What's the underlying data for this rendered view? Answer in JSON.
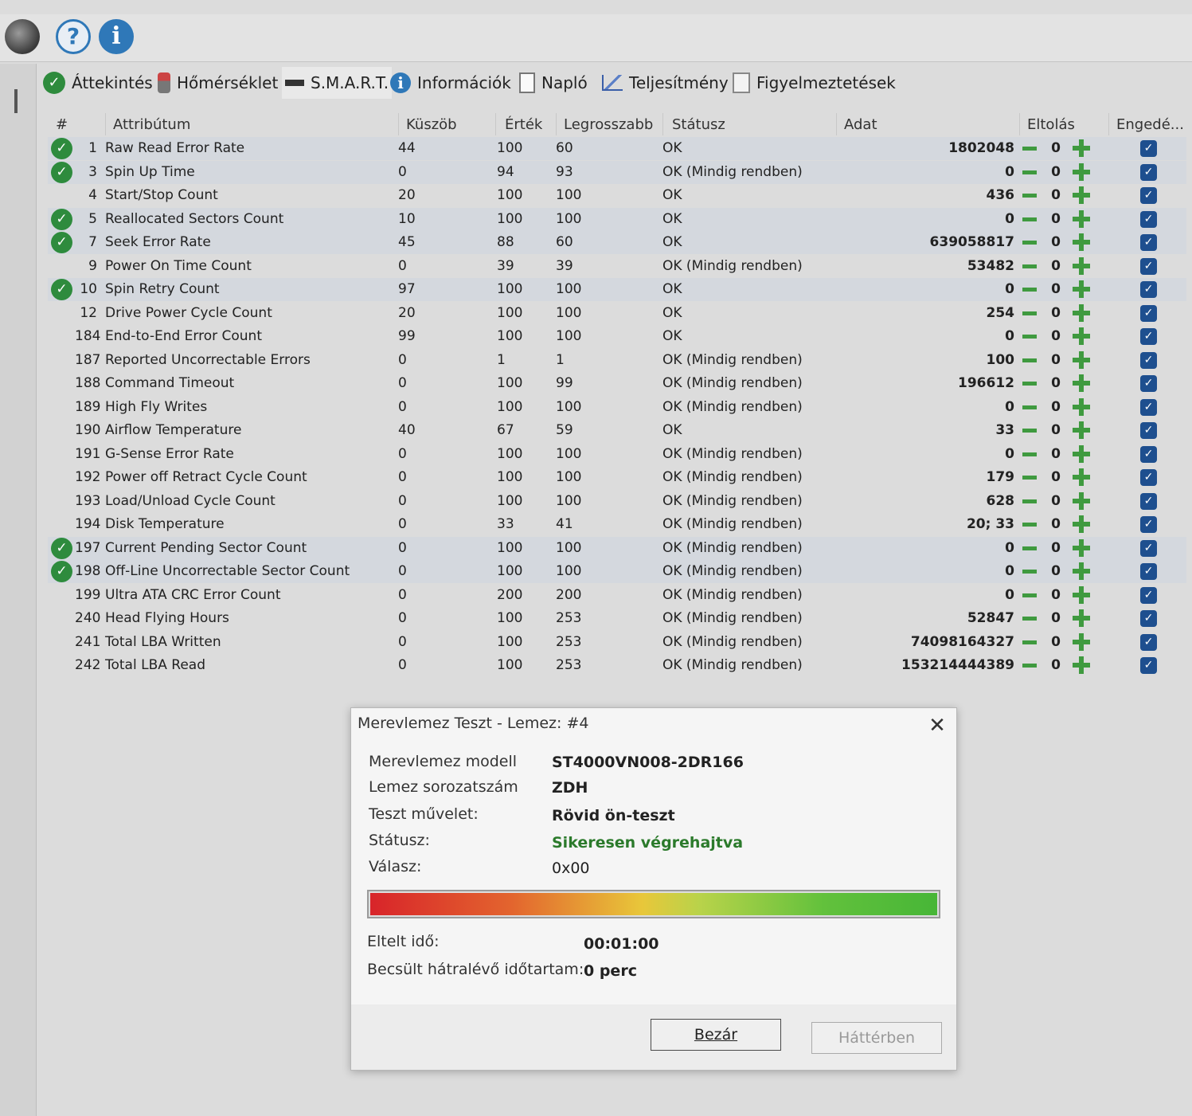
{
  "toolbar": {
    "icons": [
      "disk-icon",
      "help-icon",
      "info-icon"
    ],
    "help_glyph": "?",
    "info_glyph": "i"
  },
  "tabs": [
    {
      "label": "Áttekintés",
      "icon": "check-icon"
    },
    {
      "label": "Hőmérséklet",
      "icon": "thermometer-icon"
    },
    {
      "label": "S.M.A.R.T.",
      "icon": "smart-icon"
    },
    {
      "label": "Információk",
      "icon": "info-icon"
    },
    {
      "label": "Napló",
      "icon": "document-icon"
    },
    {
      "label": "Teljesítmény",
      "icon": "chart-icon"
    },
    {
      "label": "Figyelmeztetések",
      "icon": "warning-doc-icon"
    }
  ],
  "table": {
    "headers": {
      "num": "#",
      "attribute": "Attribútum",
      "threshold": "Küszöb",
      "value": "Érték",
      "worst": "Legrosszabb",
      "status": "Státusz",
      "data": "Adat",
      "offset": "Eltolás",
      "enabled": "Engedé..."
    },
    "rows": [
      {
        "ok": true,
        "id": "1",
        "name": "Raw Read Error Rate",
        "threshold": "44",
        "value": "100",
        "worst": "60",
        "status": "OK",
        "data": "1802048",
        "offset": "0",
        "enabled": true
      },
      {
        "ok": true,
        "id": "3",
        "name": "Spin Up Time",
        "threshold": "0",
        "value": "94",
        "worst": "93",
        "status": "OK (Mindig rendben)",
        "data": "0",
        "offset": "0",
        "enabled": true
      },
      {
        "ok": false,
        "id": "4",
        "name": "Start/Stop Count",
        "threshold": "20",
        "value": "100",
        "worst": "100",
        "status": "OK",
        "data": "436",
        "offset": "0",
        "enabled": true
      },
      {
        "ok": true,
        "id": "5",
        "name": "Reallocated Sectors Count",
        "threshold": "10",
        "value": "100",
        "worst": "100",
        "status": "OK",
        "data": "0",
        "offset": "0",
        "enabled": true
      },
      {
        "ok": true,
        "id": "7",
        "name": "Seek Error Rate",
        "threshold": "45",
        "value": "88",
        "worst": "60",
        "status": "OK",
        "data": "639058817",
        "offset": "0",
        "enabled": true
      },
      {
        "ok": false,
        "id": "9",
        "name": "Power On Time Count",
        "threshold": "0",
        "value": "39",
        "worst": "39",
        "status": "OK (Mindig rendben)",
        "data": "53482",
        "offset": "0",
        "enabled": true
      },
      {
        "ok": true,
        "id": "10",
        "name": "Spin Retry Count",
        "threshold": "97",
        "value": "100",
        "worst": "100",
        "status": "OK",
        "data": "0",
        "offset": "0",
        "enabled": true
      },
      {
        "ok": false,
        "id": "12",
        "name": "Drive Power Cycle Count",
        "threshold": "20",
        "value": "100",
        "worst": "100",
        "status": "OK",
        "data": "254",
        "offset": "0",
        "enabled": true
      },
      {
        "ok": false,
        "id": "184",
        "name": "End-to-End Error Count",
        "threshold": "99",
        "value": "100",
        "worst": "100",
        "status": "OK",
        "data": "0",
        "offset": "0",
        "enabled": true
      },
      {
        "ok": false,
        "id": "187",
        "name": "Reported Uncorrectable Errors",
        "threshold": "0",
        "value": "1",
        "worst": "1",
        "status": "OK (Mindig rendben)",
        "data": "100",
        "offset": "0",
        "enabled": true
      },
      {
        "ok": false,
        "id": "188",
        "name": "Command Timeout",
        "threshold": "0",
        "value": "100",
        "worst": "99",
        "status": "OK (Mindig rendben)",
        "data": "196612",
        "offset": "0",
        "enabled": true
      },
      {
        "ok": false,
        "id": "189",
        "name": "High Fly Writes",
        "threshold": "0",
        "value": "100",
        "worst": "100",
        "status": "OK (Mindig rendben)",
        "data": "0",
        "offset": "0",
        "enabled": true
      },
      {
        "ok": false,
        "id": "190",
        "name": "Airflow Temperature",
        "threshold": "40",
        "value": "67",
        "worst": "59",
        "status": "OK",
        "data": "33",
        "offset": "0",
        "enabled": true
      },
      {
        "ok": false,
        "id": "191",
        "name": "G-Sense Error Rate",
        "threshold": "0",
        "value": "100",
        "worst": "100",
        "status": "OK (Mindig rendben)",
        "data": "0",
        "offset": "0",
        "enabled": true
      },
      {
        "ok": false,
        "id": "192",
        "name": "Power off Retract Cycle Count",
        "threshold": "0",
        "value": "100",
        "worst": "100",
        "status": "OK (Mindig rendben)",
        "data": "179",
        "offset": "0",
        "enabled": true
      },
      {
        "ok": false,
        "id": "193",
        "name": "Load/Unload Cycle Count",
        "threshold": "0",
        "value": "100",
        "worst": "100",
        "status": "OK (Mindig rendben)",
        "data": "628",
        "offset": "0",
        "enabled": true
      },
      {
        "ok": false,
        "id": "194",
        "name": "Disk Temperature",
        "threshold": "0",
        "value": "33",
        "worst": "41",
        "status": "OK (Mindig rendben)",
        "data": "20; 33",
        "offset": "0",
        "enabled": true
      },
      {
        "ok": true,
        "id": "197",
        "name": "Current Pending Sector Count",
        "threshold": "0",
        "value": "100",
        "worst": "100",
        "status": "OK (Mindig rendben)",
        "data": "0",
        "offset": "0",
        "enabled": true
      },
      {
        "ok": true,
        "id": "198",
        "name": "Off-Line Uncorrectable Sector Count",
        "threshold": "0",
        "value": "100",
        "worst": "100",
        "status": "OK (Mindig rendben)",
        "data": "0",
        "offset": "0",
        "enabled": true
      },
      {
        "ok": false,
        "id": "199",
        "name": "Ultra ATA CRC Error Count",
        "threshold": "0",
        "value": "200",
        "worst": "200",
        "status": "OK (Mindig rendben)",
        "data": "0",
        "offset": "0",
        "enabled": true
      },
      {
        "ok": false,
        "id": "240",
        "name": "Head Flying Hours",
        "threshold": "0",
        "value": "100",
        "worst": "253",
        "status": "OK (Mindig rendben)",
        "data": "52847",
        "offset": "0",
        "enabled": true
      },
      {
        "ok": false,
        "id": "241",
        "name": "Total LBA Written",
        "threshold": "0",
        "value": "100",
        "worst": "253",
        "status": "OK (Mindig rendben)",
        "data": "74098164327",
        "offset": "0",
        "enabled": true
      },
      {
        "ok": false,
        "id": "242",
        "name": "Total LBA Read",
        "threshold": "0",
        "value": "100",
        "worst": "253",
        "status": "OK (Mindig rendben)",
        "data": "153214444389",
        "offset": "0",
        "enabled": true
      }
    ]
  },
  "dialog": {
    "title": "Merevlemez Teszt - Lemez: #4",
    "close_glyph": "✕",
    "model_label": "Merevlemez modell",
    "model_value": "ST4000VN008-2DR166",
    "serial_label": "Lemez sorozatszám",
    "serial_value": "ZDH",
    "test_label": "Teszt művelet:",
    "test_value": "Rövid ön-teszt",
    "status_label": "Státusz:",
    "status_value": "Sikeresen végrehajtva",
    "status_color": "#2b7a2b",
    "answer_label": "Válasz:",
    "answer_value": "0x00",
    "progress": 1.0,
    "elapsed_label": "Eltelt idő:",
    "elapsed_value": "00:01:00",
    "remaining_label": "Becsült hátralévő időtartam:",
    "remaining_value": "0 perc",
    "close_button": "Bezár",
    "background_button": "Háttérben"
  }
}
